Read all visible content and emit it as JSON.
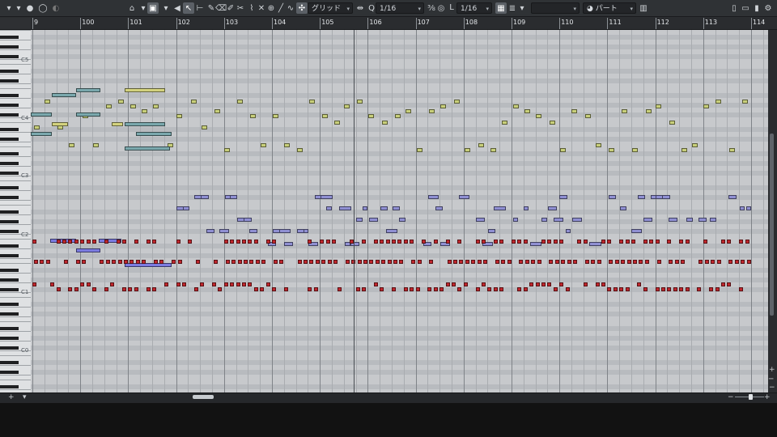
{
  "toolbar": {
    "snap_type": "グリッド",
    "quantize": "1/16",
    "length": "L",
    "length_value": "1/16",
    "part_label": "パート",
    "empty_dropdown": ""
  },
  "ruler": {
    "bars": [
      "9",
      "100",
      "101",
      "102",
      "103",
      "104",
      "105",
      "106",
      "107",
      "108",
      "109",
      "110",
      "111",
      "112",
      "113",
      "114"
    ]
  },
  "keyboard": {
    "octave_labels": [
      "C5",
      "C4",
      "C3",
      "C2",
      "C1",
      "C0"
    ]
  },
  "colors": {
    "chord_note": "#c8cf7a",
    "pad_note": "#7aa8ad",
    "lead_note": "#d3d27e",
    "mid_note": "#8f8fd2",
    "bass_note": "#c1272d",
    "long_blue": "#7b7be0"
  },
  "icons": [
    "record-icon",
    "metronome-icon",
    "pointer-icon",
    "range-icon",
    "pencil-icon",
    "eraser-icon",
    "split-icon",
    "glue-icon",
    "mute-icon",
    "zoom-icon",
    "line-icon",
    "quantize-icon",
    "snap-icon",
    "piano-icon"
  ]
}
